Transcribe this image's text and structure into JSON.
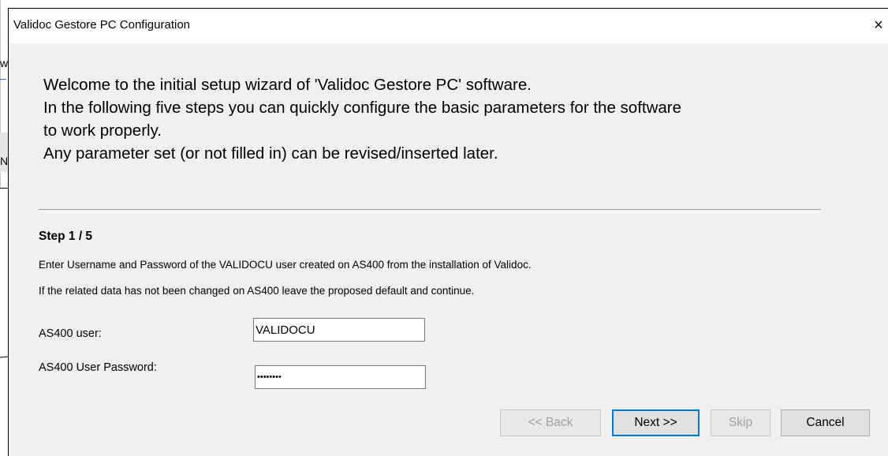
{
  "background": {
    "fragments": [
      "w",
      "N"
    ]
  },
  "dialog": {
    "title": "Validoc Gestore PC Configuration",
    "close_glyph": "×",
    "intro": [
      "Welcome to the initial setup wizard of 'Validoc Gestore PC' software.",
      "In the following five steps you can quickly configure the basic parameters for the software",
      "to work properly.",
      "Any parameter set (or not filled in) can be revised/inserted later."
    ],
    "step": {
      "title": "Step 1 / 5",
      "desc1": "Enter Username and Password of the VALIDOCU user created on AS400 from the installation of Validoc.",
      "desc2": "If the related data has not been changed on AS400 leave the proposed default and continue."
    },
    "fields": {
      "user_label": "AS400 user:",
      "user_value": "VALIDOCU",
      "password_label": "AS400 User Password:",
      "password_value": "validocu"
    },
    "buttons": {
      "back": "<< Back",
      "next": "Next >>",
      "skip": "Skip",
      "cancel": "Cancel"
    }
  }
}
